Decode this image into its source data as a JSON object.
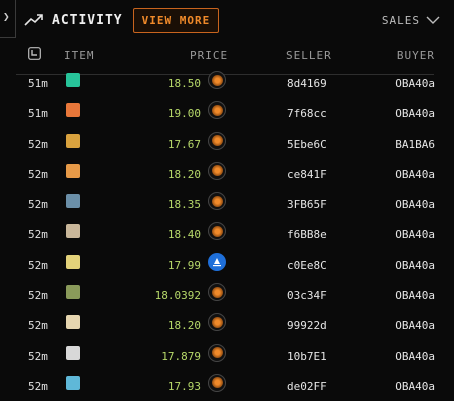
{
  "header": {
    "title": "ACTIVITY",
    "view_more_label": "VIEW MORE",
    "filter_label": "SALES"
  },
  "columns": {
    "item": "ITEM",
    "price": "PRICE",
    "seller": "SELLER",
    "buyer": "BUYER"
  },
  "rows": [
    {
      "time": "51m",
      "color": "#27c49a",
      "price": "18.50",
      "marketplace": "orange-token",
      "seller": "8d4169",
      "buyer": "OBA40a"
    },
    {
      "time": "51m",
      "color": "#e8773a",
      "price": "19.00",
      "marketplace": "orange-token",
      "seller": "7f68cc",
      "buyer": "OBA40a"
    },
    {
      "time": "52m",
      "color": "#d9a23e",
      "price": "17.67",
      "marketplace": "orange-token",
      "seller": "5Ebe6C",
      "buyer": "BA1BA6"
    },
    {
      "time": "52m",
      "color": "#e79a48",
      "price": "18.20",
      "marketplace": "orange-token",
      "seller": "ce841F",
      "buyer": "OBA40a"
    },
    {
      "time": "52m",
      "color": "#6b8fa8",
      "price": "18.35",
      "marketplace": "orange-token",
      "seller": "3FB65F",
      "buyer": "OBA40a"
    },
    {
      "time": "52m",
      "color": "#c9b79a",
      "price": "18.40",
      "marketplace": "orange-token",
      "seller": "f6BB8e",
      "buyer": "OBA40a"
    },
    {
      "time": "52m",
      "color": "#e3d27a",
      "price": "17.99",
      "marketplace": "blue-sail",
      "seller": "c0Ee8C",
      "buyer": "OBA40a"
    },
    {
      "time": "52m",
      "color": "#8a9a5a",
      "price": "18.0392",
      "marketplace": "orange-token",
      "seller": "03c34F",
      "buyer": "OBA40a"
    },
    {
      "time": "52m",
      "color": "#e6d6b0",
      "price": "18.20",
      "marketplace": "orange-token",
      "seller": "99922d",
      "buyer": "OBA40a"
    },
    {
      "time": "52m",
      "color": "#d8d8d8",
      "price": "17.879",
      "marketplace": "orange-token",
      "seller": "10b7E1",
      "buyer": "OBA40a"
    },
    {
      "time": "52m",
      "color": "#5fb8d8",
      "price": "17.93",
      "marketplace": "orange-token",
      "seller": "de02FF",
      "buyer": "OBA40a"
    }
  ],
  "colors": {
    "accent": "#f08a2a",
    "price": "#b7d96a",
    "background": "#0a0a0a"
  }
}
